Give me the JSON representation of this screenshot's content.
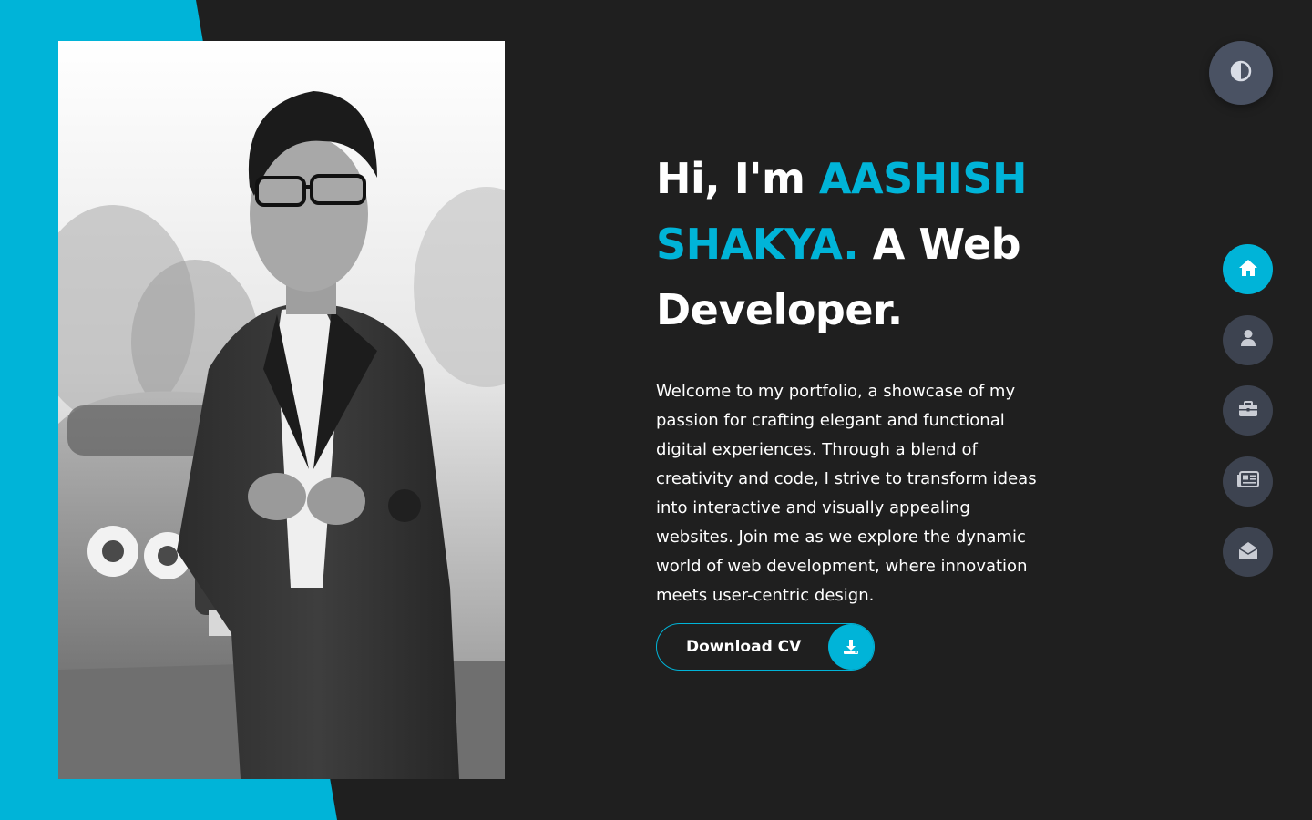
{
  "colors": {
    "accent": "#00b4d8",
    "background": "#1f1f1f",
    "nav_button": "#3d4350",
    "toggle_button": "#4a5263",
    "text": "#ffffff"
  },
  "hero": {
    "greeting": "Hi, I'm ",
    "name": "AASHISH SHAKYA.",
    "role": " A Web Developer.",
    "intro": "Welcome to my portfolio, a showcase of my passion for crafting elegant and functional digital experiences. Through a blend of creativity and code, I strive to transform ideas into interactive and visually appealing websites. Join me as we explore the dynamic world of web development, where innovation meets user-centric design."
  },
  "cta": {
    "label": "Download CV",
    "icon": "download-icon"
  },
  "theme_toggle": {
    "icon": "contrast-icon"
  },
  "nav": {
    "items": [
      {
        "name": "home",
        "icon": "home-icon",
        "active": true
      },
      {
        "name": "about",
        "icon": "user-icon",
        "active": false
      },
      {
        "name": "portfolio",
        "icon": "briefcase-icon",
        "active": false
      },
      {
        "name": "blog",
        "icon": "newspaper-icon",
        "active": false
      },
      {
        "name": "contact",
        "icon": "envelope-open-icon",
        "active": false
      }
    ]
  }
}
